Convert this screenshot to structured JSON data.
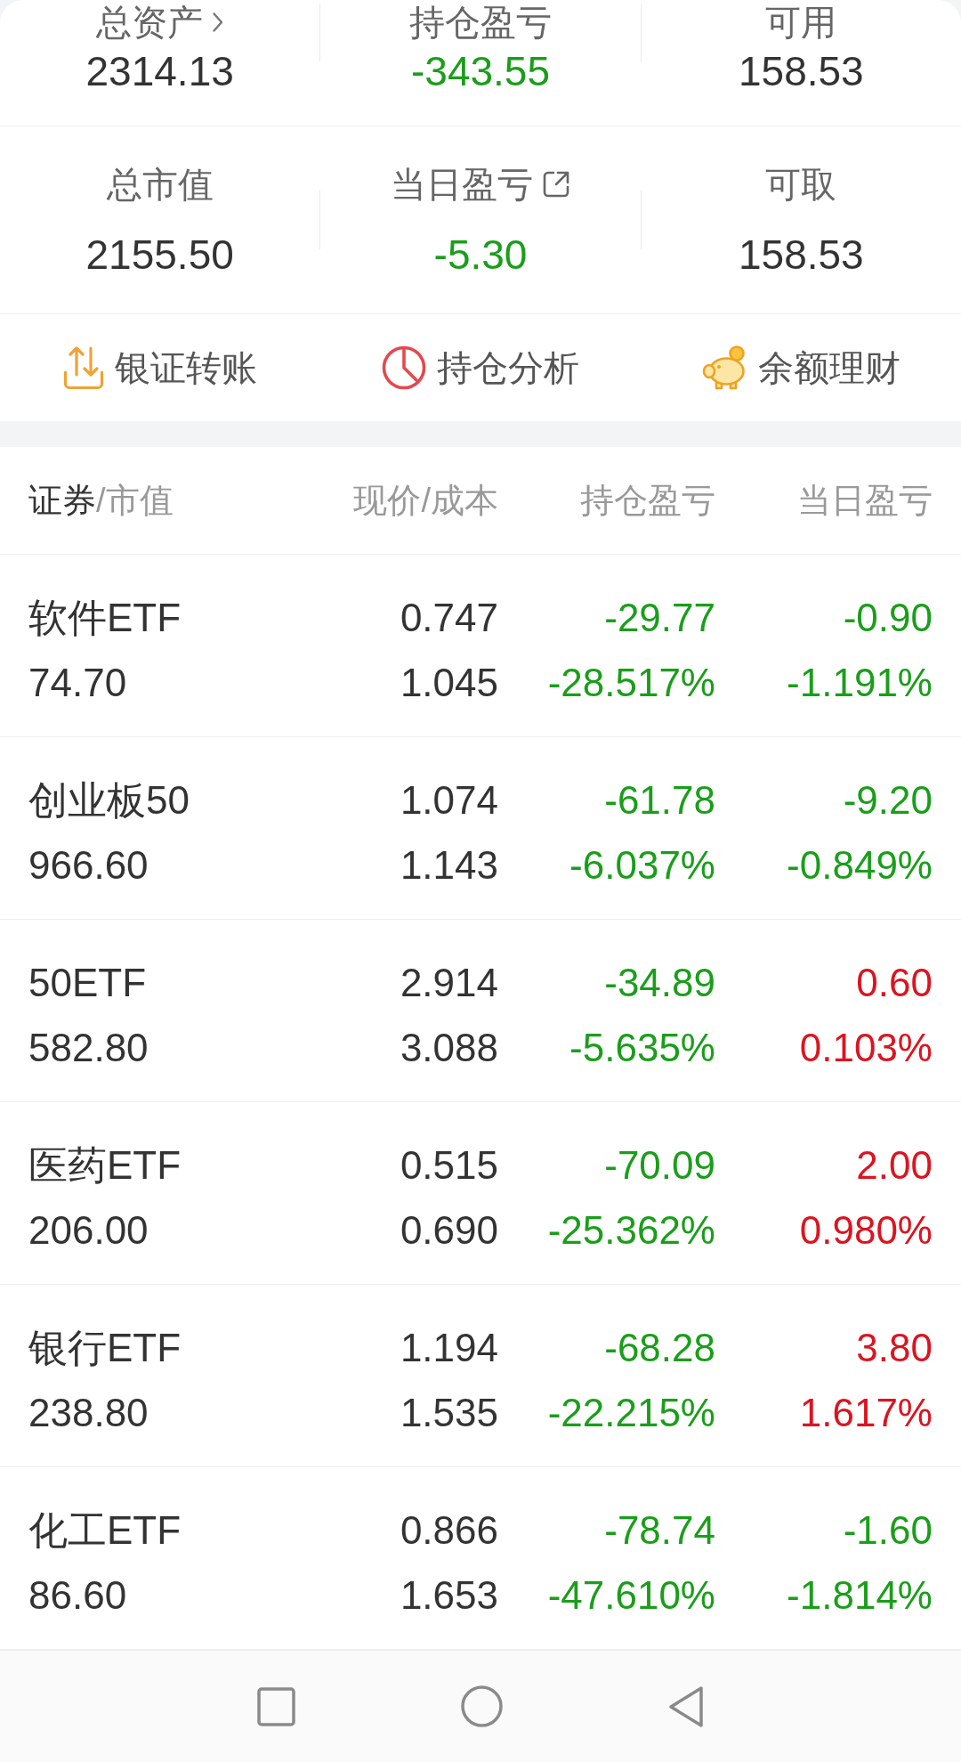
{
  "summary_rows": [
    {
      "stats": [
        {
          "label": "总资产",
          "kind": "detail",
          "value": "2314.13",
          "color": "#333333"
        },
        {
          "label": "持仓盈亏",
          "kind": "plain",
          "value": "-343.55",
          "color": "#1a9e1a"
        },
        {
          "label": "可用",
          "kind": "plain",
          "value": "158.53",
          "color": "#333333"
        }
      ]
    },
    {
      "stats": [
        {
          "label": "总市值",
          "kind": "plain",
          "value": "2155.50",
          "color": "#333333"
        },
        {
          "label": "当日盈亏",
          "kind": "popup",
          "value": "-5.30",
          "color": "#1a9e1a"
        },
        {
          "label": "可取",
          "kind": "plain",
          "value": "158.53",
          "color": "#333333"
        }
      ]
    }
  ],
  "actions": [
    {
      "label": "银证转账",
      "kind": "transfer"
    },
    {
      "label": "持仓分析",
      "kind": "analysis"
    },
    {
      "label": "余额理财",
      "kind": "savings"
    }
  ],
  "table": {
    "columns": [
      {
        "label": "证券",
        "sublabel": "/市值",
        "selected": true
      },
      {
        "label": "现价/成本",
        "selected": false
      },
      {
        "label": "持仓盈亏",
        "selected": false
      },
      {
        "label": "当日盈亏",
        "selected": false
      }
    ],
    "rows": [
      {
        "name": "软件ETF",
        "market_value": "74.70",
        "price": "0.747",
        "cost": "1.045",
        "position_pnl": {
          "amount": "-29.77",
          "percent": "-28.517%",
          "color": "#1a9e1a"
        },
        "day_pnl": {
          "amount": "-0.90",
          "percent": "-1.191%",
          "color": "#1a9e1a"
        }
      },
      {
        "name": "创业板50",
        "market_value": "966.60",
        "price": "1.074",
        "cost": "1.143",
        "position_pnl": {
          "amount": "-61.78",
          "percent": "-6.037%",
          "color": "#1a9e1a"
        },
        "day_pnl": {
          "amount": "-9.20",
          "percent": "-0.849%",
          "color": "#1a9e1a"
        }
      },
      {
        "name": "50ETF",
        "market_value": "582.80",
        "price": "2.914",
        "cost": "3.088",
        "position_pnl": {
          "amount": "-34.89",
          "percent": "-5.635%",
          "color": "#1a9e1a"
        },
        "day_pnl": {
          "amount": "0.60",
          "percent": "0.103%",
          "color": "#dc1420"
        }
      },
      {
        "name": "医药ETF",
        "market_value": "206.00",
        "price": "0.515",
        "cost": "0.690",
        "position_pnl": {
          "amount": "-70.09",
          "percent": "-25.362%",
          "color": "#1a9e1a"
        },
        "day_pnl": {
          "amount": "2.00",
          "percent": "0.980%",
          "color": "#dc1420"
        }
      },
      {
        "name": "银行ETF",
        "market_value": "238.80",
        "price": "1.194",
        "cost": "1.535",
        "position_pnl": {
          "amount": "-68.28",
          "percent": "-22.215%",
          "color": "#1a9e1a"
        },
        "day_pnl": {
          "amount": "3.80",
          "percent": "1.617%",
          "color": "#dc1420"
        }
      },
      {
        "name": "化工ETF",
        "market_value": "86.60",
        "price": "0.866",
        "cost": "1.653",
        "position_pnl": {
          "amount": "-78.74",
          "percent": "-47.610%",
          "color": "#1a9e1a"
        },
        "day_pnl": {
          "amount": "-1.60",
          "percent": "-1.814%",
          "color": "#1a9e1a"
        }
      }
    ]
  }
}
